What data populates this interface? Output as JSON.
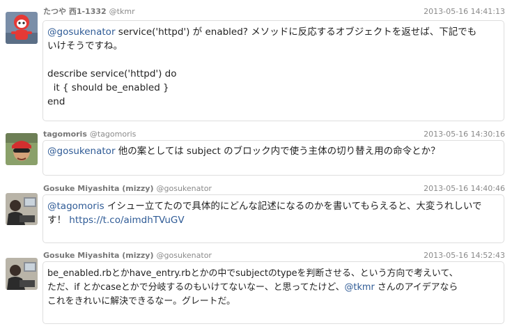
{
  "tweets": [
    {
      "name": "たつや 西1-1332",
      "handle": "@tkmr",
      "time": "2013-05-16 14:41:13",
      "mention": "@gosukenator",
      "text1": " service('httpd') が enabled? メソッドに反応するオブジェクトを返せば、下記でも",
      "text2": "いけそうですね。",
      "code": [
        "describe service('httpd') do",
        "  it { should be_enabled }",
        "end"
      ]
    },
    {
      "name": "tagomoris",
      "handle": "@tagomoris",
      "time": "2013-05-16 14:30:16",
      "mention": "@gosukenator",
      "text1": " 他の案としては subject のブロック内で使う主体の切り替え用の命令とか？"
    },
    {
      "name": "Gosuke Miyashita (mizzy)",
      "handle": "@gosukenator",
      "time": "2013-05-16 14:40:46",
      "mention": "@tagomoris",
      "text1": " イシュー立てたので具体的にどんな記述になるのかを書いてもらえると、大変うれしいで",
      "text2": "す！ ",
      "link": "https://t.co/aimdhTVuGV"
    },
    {
      "name": "Gosuke Miyashita (mizzy)",
      "handle": "@gosukenator",
      "time": "2013-05-16 14:52:43",
      "line1": "be_enabled.rbとかhave_entry.rbとかの中でsubjectのtypeを判断させる、という方向で考えいて、",
      "line2a": "ただ、if とかcaseとかで分岐するのもいけてないなー、と思ってたけど、",
      "mention": "@tkmr",
      "line2b": " さんのアイデアなら",
      "line3": "これをきれいに解決できるなー。グレートだ。"
    }
  ]
}
